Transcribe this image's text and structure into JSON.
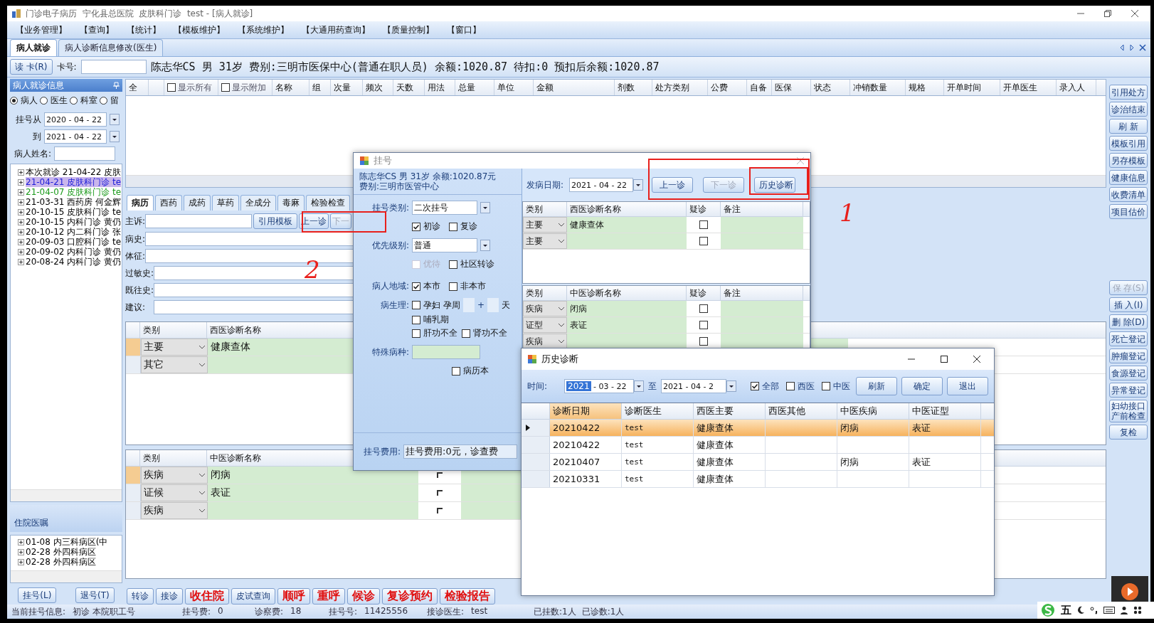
{
  "window": {
    "title": "门诊电子病历  宁化县总医院  皮肤科门诊  test - [病人就诊]"
  },
  "menu": [
    "【业务管理】",
    "【查询】",
    "【统计】",
    "【模板维护】",
    "【系统维护】",
    "【大通用药查询】",
    "【质量控制】",
    "【窗口】"
  ],
  "tabs": [
    {
      "label": "病人就诊",
      "selected": true
    },
    {
      "label": "病人诊断信息修改(医生)",
      "selected": false
    }
  ],
  "patient_bar": {
    "read_card_button": "读 卡(R)",
    "card_label": "卡号:",
    "summary": "陈志华CS 男 31岁 费别:三明市医保中心(普通在职人员) 余额:1020.87 待扣:0 预扣后余额:1020.87"
  },
  "left_panel": {
    "title": "病人就诊信息",
    "filters": [
      {
        "label": "病人",
        "selected": true
      },
      {
        "label": "医生",
        "selected": false
      },
      {
        "label": "科室",
        "selected": false
      },
      {
        "label": "留",
        "selected": false
      }
    ],
    "date_from_label": "挂号从",
    "date_from": "2020 - 04 - 22",
    "date_to_label": "到",
    "date_to": "2021 - 04 - 22",
    "name_label": "病人姓名:",
    "visits": [
      {
        "text": "本次就诊 21-04-22 皮肤",
        "color": "#000000",
        "selected": false
      },
      {
        "text": "21-04-21 皮肤科门诊 te",
        "color": "#1c1cd8",
        "selected": true
      },
      {
        "text": "21-04-07 皮肤科门诊 te",
        "color": "#1a9a1a",
        "selected": false
      },
      {
        "text": "21-03-31 西药房 何金辉",
        "color": "#000000",
        "selected": false
      },
      {
        "text": "20-10-15 皮肤科门诊 te",
        "color": "#000000",
        "selected": false
      },
      {
        "text": "20-10-15 内科门诊 黄仍",
        "color": "#000000",
        "selected": false
      },
      {
        "text": "20-10-12 内二科门诊 张",
        "color": "#000000",
        "selected": false
      },
      {
        "text": "20-09-03 口腔科门诊 te",
        "color": "#000000",
        "selected": false
      },
      {
        "text": "20-09-02 内科门诊 黄仍",
        "color": "#000000",
        "selected": false
      },
      {
        "text": "20-08-24 内科门诊 黄仍",
        "color": "#000000",
        "selected": false
      }
    ],
    "inpatient_title": "住院医嘱",
    "inpatient_orders": [
      "01-08 内三科病区(中",
      "02-28 外四科病区",
      "02-28 外四科病区"
    ],
    "buttons": [
      "挂号(L)",
      "退号(T)"
    ]
  },
  "order_grid": {
    "columns": [
      {
        "kind": "text",
        "label": "全"
      },
      {
        "kind": "blank"
      },
      {
        "kind": "check",
        "label": "显示所有",
        "checked": false
      },
      {
        "kind": "check",
        "label": "显示附加",
        "checked": false
      },
      {
        "kind": "text",
        "label": "名称"
      },
      {
        "kind": "text",
        "label": "组"
      },
      {
        "kind": "text",
        "label": "次量"
      },
      {
        "kind": "text",
        "label": "频次"
      },
      {
        "kind": "text",
        "label": "天数"
      },
      {
        "kind": "text",
        "label": "用法"
      },
      {
        "kind": "text",
        "label": "总量"
      },
      {
        "kind": "text",
        "label": "单位"
      },
      {
        "kind": "text",
        "label": "金额"
      },
      {
        "kind": "text",
        "label": "剂数"
      },
      {
        "kind": "text",
        "label": "处方类别"
      },
      {
        "kind": "text",
        "label": "公费"
      },
      {
        "kind": "text",
        "label": "自备"
      },
      {
        "kind": "text",
        "label": "医保"
      },
      {
        "kind": "text",
        "label": "状态"
      },
      {
        "kind": "text",
        "label": "冲销数量"
      },
      {
        "kind": "text",
        "label": "规格"
      },
      {
        "kind": "text",
        "label": "开单时间"
      },
      {
        "kind": "text",
        "label": "开单医生"
      },
      {
        "kind": "text",
        "label": "录入人"
      }
    ]
  },
  "record_tabs": [
    {
      "label": "病历",
      "selected": true
    },
    {
      "label": "西药",
      "selected": false
    },
    {
      "label": "成药",
      "selected": false
    },
    {
      "label": "草药",
      "selected": false
    },
    {
      "label": "全成分",
      "selected": false
    },
    {
      "label": "毒麻",
      "selected": false
    },
    {
      "label": "检验检查",
      "selected": false
    }
  ],
  "record_form": {
    "fields": [
      "主诉:",
      "病史:",
      "体征:",
      "过敏史:",
      "既往史:",
      "建议:"
    ],
    "template_button": "引用模板",
    "prev_button": "上一诊",
    "next_button": "下一"
  },
  "western_grid": {
    "columns": [
      "类别",
      "西医诊断名称"
    ],
    "rows": [
      {
        "category": "主要",
        "name": "健康查体",
        "current": true
      },
      {
        "category": "其它",
        "current": false
      }
    ]
  },
  "tcm_grid": {
    "columns": [
      "类别",
      "中医诊断名称"
    ],
    "rows": [
      {
        "category": "疾病",
        "name": "闭病",
        "current": true,
        "suspected": false
      },
      {
        "category": "证候",
        "name": "表证",
        "current": false,
        "suspected": false
      },
      {
        "category": "疾病",
        "current": false,
        "suspected": false
      }
    ]
  },
  "bottom_toolbar": [
    {
      "label": "转诊",
      "kind": "normal"
    },
    {
      "label": "接诊",
      "kind": "normal"
    },
    {
      "label": "收住院",
      "kind": "alert"
    },
    {
      "label": "皮试查询",
      "kind": "normal"
    },
    {
      "label": "顺呼",
      "kind": "alert"
    },
    {
      "label": "重呼",
      "kind": "alert"
    },
    {
      "label": "候诊",
      "kind": "alert"
    },
    {
      "label": "复诊预约",
      "kind": "alert"
    },
    {
      "label": "检验报告",
      "kind": "alert"
    }
  ],
  "right_buttons_top": [
    {
      "label": "引用处方",
      "disabled": false
    },
    {
      "label": "诊治结束",
      "disabled": false
    },
    {
      "label": "刷 新",
      "disabled": false
    },
    {
      "label": "模板引用",
      "disabled": false
    },
    {
      "label": "另存模板",
      "disabled": false
    },
    {
      "label": "健康信息",
      "disabled": false
    },
    {
      "label": "收费清单",
      "disabled": false
    },
    {
      "label": "项目估价",
      "disabled": false
    }
  ],
  "right_buttons_bottom": [
    {
      "label": "保 存(S)",
      "disabled": true
    },
    {
      "label": "插 入(I)",
      "disabled": false
    },
    {
      "label": "删 除(D)",
      "disabled": false
    },
    {
      "label": "死亡登记",
      "disabled": false
    },
    {
      "label": "肿瘤登记",
      "disabled": false
    },
    {
      "label": "食源登记",
      "disabled": false
    },
    {
      "label": "异常登记",
      "disabled": false
    },
    {
      "label": "妇幼接口产前检查",
      "disabled": false
    },
    {
      "label": "复检",
      "disabled": false
    }
  ],
  "status_bar": {
    "items": [
      {
        "label": "当前挂号信息:",
        "value": "初诊 本院职工号"
      },
      {
        "label": "挂号费:",
        "value": "0"
      },
      {
        "label": "诊察费:",
        "value": "18"
      },
      {
        "label": "挂号号:",
        "value": "11425556"
      },
      {
        "label": "接诊医生:",
        "value": "test"
      }
    ],
    "counts": [
      "已挂数:1人",
      "已诊数:1人"
    ]
  },
  "register_dialog": {
    "title": "挂号",
    "patient_line": "陈志华CS 男 31岁 余额:1020.87元",
    "fee_type": "费别:三明市医管中心",
    "type_label": "挂号类别:",
    "type_value": "二次挂号",
    "visit_checks": [
      {
        "label": "初诊",
        "checked": true,
        "disabled": false
      },
      {
        "label": "复诊",
        "checked": false,
        "disabled": false
      }
    ],
    "priority_label": "优先级别:",
    "priority_value": "普通",
    "priority_checks": [
      {
        "label": "优待",
        "checked": false,
        "disabled": true
      },
      {
        "label": "社区转诊",
        "checked": false,
        "disabled": false
      }
    ],
    "region_label": "病人地域:",
    "region_checks": [
      {
        "label": "本市",
        "checked": true,
        "disabled": false
      },
      {
        "label": "非本市",
        "checked": false,
        "disabled": false
      }
    ],
    "physio_label": "病生理:",
    "pregnant": {
      "label": "孕妇",
      "checked": false
    },
    "week_label": "孕周",
    "plus": "+",
    "day_label": "天",
    "lactation": {
      "label": "哺乳期",
      "checked": false
    },
    "organ_checks": [
      {
        "label": "肝功不全",
        "checked": false,
        "disabled": false
      },
      {
        "label": "肾功不全",
        "checked": false,
        "disabled": false
      }
    ],
    "special_label": "特殊病种:",
    "record_book": {
      "label": "病历本",
      "checked": false
    },
    "fee_label": "挂号费用:",
    "fee_value": "挂号费用:0元，诊查费",
    "onset_label": "发病日期:",
    "onset_date": "2021 - 04 - 22",
    "buttons": [
      {
        "label": "上一诊",
        "disabled": false
      },
      {
        "label": "下一诊",
        "disabled": true
      },
      {
        "label": "历史诊断",
        "disabled": false
      }
    ],
    "western_grid": {
      "columns": [
        "类别",
        "西医诊断名称",
        "疑诊",
        "备注"
      ],
      "rows": [
        {
          "category": "主要",
          "name": "健康查体",
          "suspected": false
        },
        {
          "category": "主要",
          "suspected": false
        }
      ]
    },
    "tcm_grid": {
      "columns": [
        "类别",
        "中医诊断名称",
        "疑诊",
        "备注"
      ],
      "rows": [
        {
          "category": "疾病",
          "name": "闭病",
          "suspected": false
        },
        {
          "category": "证型",
          "name": "表证",
          "suspected": false
        },
        {
          "category": "疾病",
          "suspected": false
        }
      ]
    }
  },
  "history_dialog": {
    "title": "历史诊断",
    "time_label": "时间:",
    "from_year": "2021",
    "from_rest": "- 03 - 22",
    "to_label": "至",
    "to_date": "2021 - 04 - 2",
    "filters": [
      {
        "label": "全部",
        "checked": true
      },
      {
        "label": "西医",
        "checked": false
      },
      {
        "label": "中医",
        "checked": false
      }
    ],
    "buttons": [
      "刷新",
      "确定",
      "退出"
    ],
    "columns": [
      "诊断日期",
      "诊断医生",
      "西医主要",
      "西医其他",
      "中医疾病",
      "中医证型"
    ],
    "rows": [
      {
        "cells": [
          "20210422",
          "test",
          "健康查体",
          null,
          "闭病",
          "表证"
        ],
        "selected": true
      },
      {
        "cells": [
          "20210422",
          "test",
          "健康查体",
          null,
          null,
          null
        ],
        "selected": false
      },
      {
        "cells": [
          "20210407",
          "test",
          "健康查体",
          null,
          "闭病",
          "表证"
        ],
        "selected": false
      },
      {
        "cells": [
          "20210331",
          "test",
          "健康查体",
          null,
          null,
          null
        ],
        "selected": false
      }
    ]
  },
  "annotations": [
    "1",
    "2"
  ],
  "ime_bar": {
    "mode": "五"
  }
}
